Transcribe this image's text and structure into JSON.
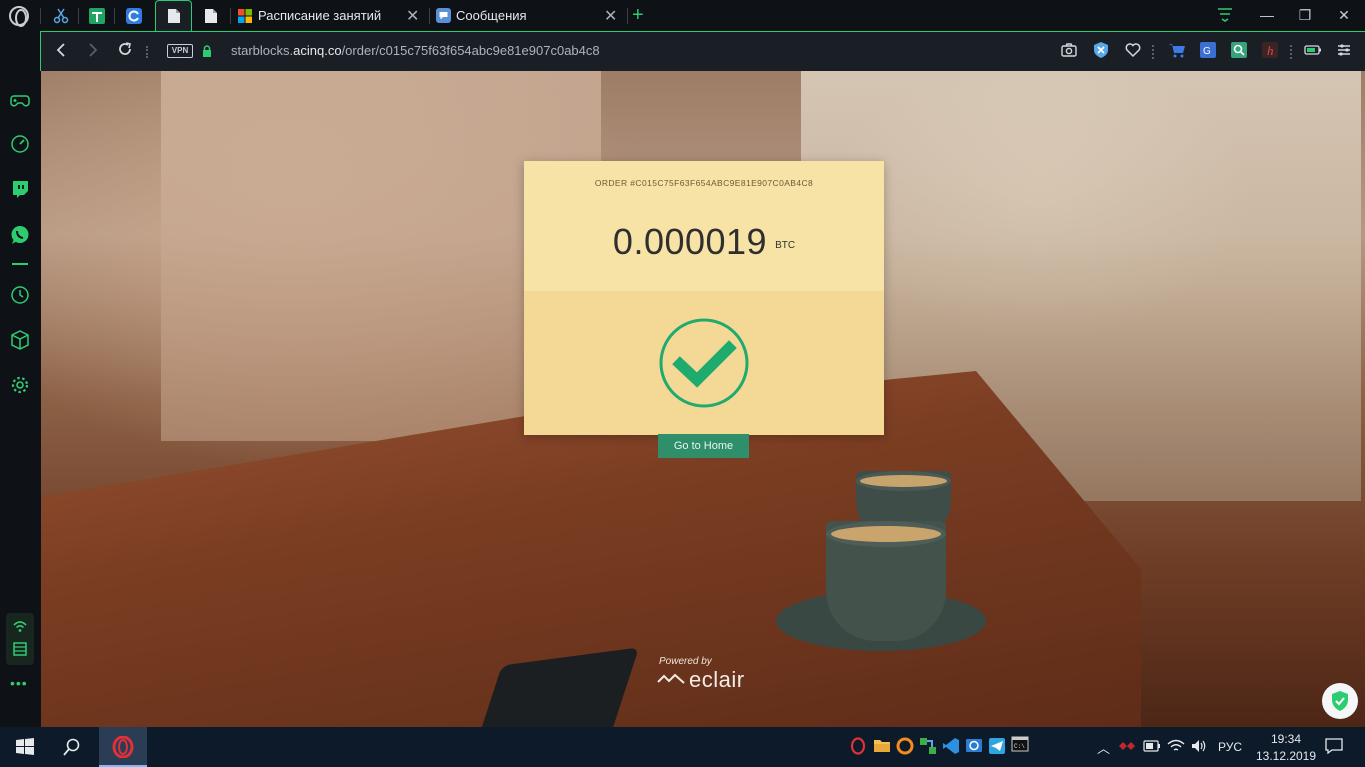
{
  "tabs": [
    {
      "label": "",
      "icon": "scissors-icon"
    },
    {
      "label": "",
      "icon": "table-icon"
    },
    {
      "label": "",
      "icon": "edge-icon"
    },
    {
      "label": "",
      "icon": "document-icon",
      "active": true
    },
    {
      "label": "",
      "icon": "document-icon"
    },
    {
      "label": "Расписание занятий",
      "icon": "microsoft-icon"
    },
    {
      "label": "Сообщения",
      "icon": "chat-icon"
    }
  ],
  "address": {
    "vpn_label": "VPN",
    "url_prefix": "starblocks.",
    "url_domain": "acinq.co",
    "url_path": "/order/c015c75f63f654abc9e81e907c0ab4c8"
  },
  "page": {
    "order_label": "ORDER #C015C75F63F654ABC9E81E907C0AB4C8",
    "amount": "0.000019",
    "unit": "BTC",
    "button_label": "Go to Home",
    "powered_by": "Powered by",
    "brand": "eclair"
  },
  "taskbar": {
    "language": "РУС",
    "time": "19:34",
    "date": "13.12.2019"
  },
  "colors": {
    "accent": "#2ecc71",
    "card_top": "#f8e3a7",
    "card_bottom": "#f3d896",
    "check": "#1faa6e",
    "button": "#2e8f6a",
    "taskbar": "#0c1a2a"
  }
}
